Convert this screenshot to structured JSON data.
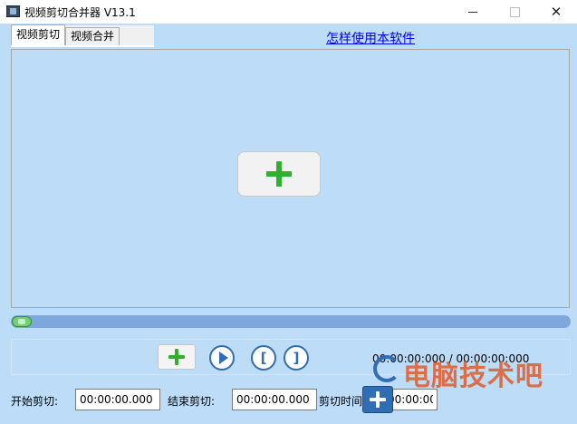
{
  "window": {
    "title": "视频剪切合并器 V13.1",
    "close_glyph": "✕"
  },
  "tabs": [
    {
      "label": "视频剪切",
      "active": true
    },
    {
      "label": "视频合并",
      "active": false
    }
  ],
  "help_link": "怎样使用本软件",
  "player": {
    "add_video_icon": "green-plus-icon",
    "progress": 0.0
  },
  "controls": {
    "start_mark_glyph": "[",
    "end_mark_glyph": "]",
    "time_readout": "00:00:00:000 / 00:00:00:000"
  },
  "bottom": {
    "start_label": "开始剪切:",
    "start_value": "00:00:00.000",
    "end_label": "结束剪切:",
    "end_value": "00:00:00.000",
    "duration_label": "剪切时间:",
    "duration_value": "00:00:00.000"
  },
  "watermark": {
    "text": "电脑技术吧"
  },
  "colors": {
    "background": "#bcdcf8",
    "accent_green": "#2fb12f",
    "accent_blue": "#2f6db5",
    "link": "#0000ee"
  }
}
